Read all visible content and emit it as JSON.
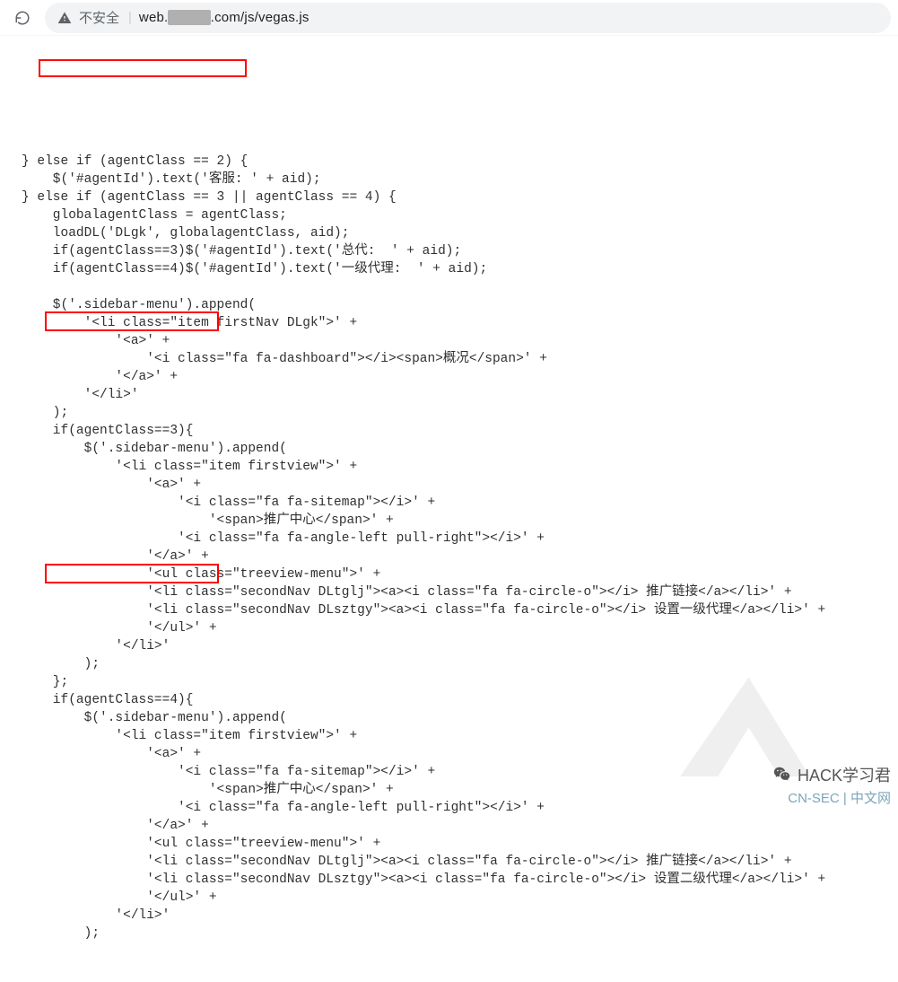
{
  "addressbar": {
    "not_secure_label": "不安全",
    "url_prefix": "web.",
    "url_hidden": "████",
    "url_suffix": ".com/js/vegas.js"
  },
  "code": {
    "lines": [
      "} else if (agentClass == 2) {",
      "    $('#agentId').text('客服: ' + aid);",
      "} else if (agentClass == 3 || agentClass == 4) {",
      "    globalagentClass = agentClass;",
      "    loadDL('DLgk', globalagentClass, aid);",
      "    if(agentClass==3)$('#agentId').text('总代:  ' + aid);",
      "    if(agentClass==4)$('#agentId').text('一级代理:  ' + aid);",
      "",
      "    $('.sidebar-menu').append(",
      "        '<li class=\"item firstNav DLgk\">' +",
      "            '<a>' +",
      "                '<i class=\"fa fa-dashboard\"></i><span>概况</span>' +",
      "            '</a>' +",
      "        '</li>'",
      "    );",
      "    if(agentClass==3){",
      "        $('.sidebar-menu').append(",
      "            '<li class=\"item firstview\">' +",
      "                '<a>' +",
      "                    '<i class=\"fa fa-sitemap\"></i>' +",
      "                        '<span>推广中心</span>' +",
      "                    '<i class=\"fa fa-angle-left pull-right\"></i>' +",
      "                '</a>' +",
      "                '<ul class=\"treeview-menu\">' +",
      "                '<li class=\"secondNav DLtglj\"><a><i class=\"fa fa-circle-o\"></i> 推广链接</a></li>' +",
      "                '<li class=\"secondNav DLsztgy\"><a><i class=\"fa fa-circle-o\"></i> 设置一级代理</a></li>' +",
      "                '</ul>' +",
      "            '</li>'",
      "        );",
      "    };",
      "    if(agentClass==4){",
      "        $('.sidebar-menu').append(",
      "            '<li class=\"item firstview\">' +",
      "                '<a>' +",
      "                    '<i class=\"fa fa-sitemap\"></i>' +",
      "                        '<span>推广中心</span>' +",
      "                    '<i class=\"fa fa-angle-left pull-right\"></i>' +",
      "                '</a>' +",
      "                '<ul class=\"treeview-menu\">' +",
      "                '<li class=\"secondNav DLtglj\"><a><i class=\"fa fa-circle-o\"></i> 推广链接</a></li>' +",
      "                '<li class=\"secondNav DLsztgy\"><a><i class=\"fa fa-circle-o\"></i> 设置二级代理</a></li>' +",
      "                '</ul>' +",
      "            '</li>'",
      "        );"
    ]
  },
  "watermark": {
    "main": "HACK学习君",
    "sub": "CN-SEC | 中文网"
  }
}
